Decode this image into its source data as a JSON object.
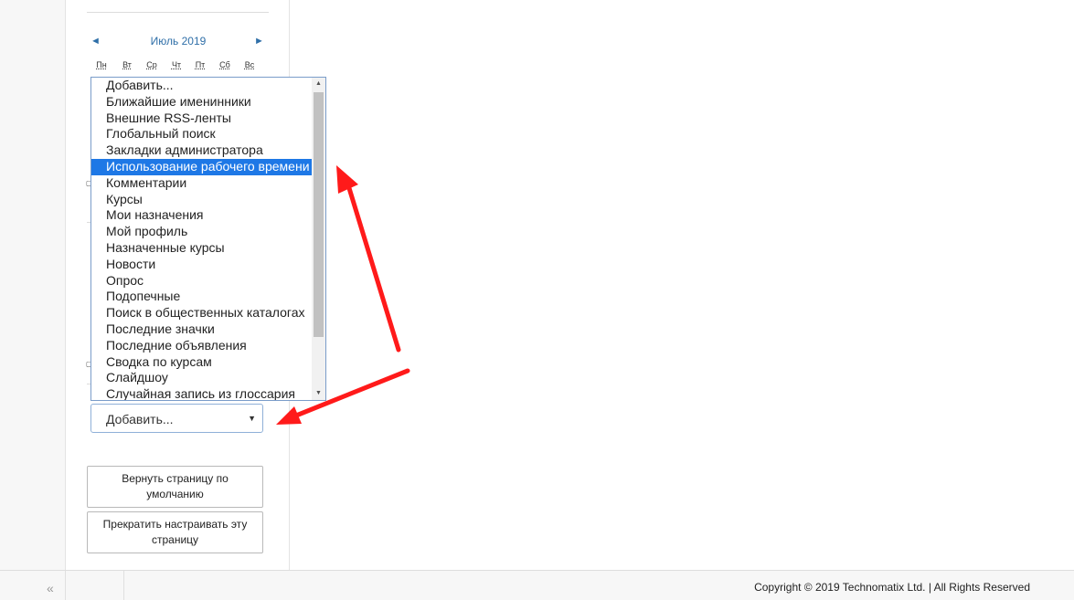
{
  "calendar": {
    "prev_icon": "triangle-left-icon",
    "next_icon": "triangle-right-icon",
    "prev_glyph": "◄",
    "next_glyph": "►",
    "title": "Июль 2019",
    "days": [
      "Пн",
      "Вт",
      "Ср",
      "Чт",
      "Пт",
      "Сб",
      "Вс"
    ]
  },
  "block_list": {
    "items": [
      "Добавить...",
      "Ближайшие именинники",
      "Внешние RSS-ленты",
      "Глобальный поиск",
      "Закладки администратора",
      "Использование рабочего времени",
      "Комментарии",
      "Курсы",
      "Мои назначения",
      "Мой профиль",
      "Назначенные курсы",
      "Новости",
      "Опрос",
      "Подопечные",
      "Поиск в общественных каталогах",
      "Последние значки",
      "Последние объявления",
      "Сводка по курсам",
      "Слайдшоу",
      "Случайная запись из глоссария"
    ],
    "selected_item": "Использование рабочего времени"
  },
  "add_block": {
    "value": "Добавить...",
    "caret": "▼"
  },
  "buttons": {
    "reset": "Вернуть страницу по умолчанию",
    "stop": "Прекратить настраивать эту страницу"
  },
  "footer": {
    "collapse_glyph": "«",
    "copyright": "Copyright © 2019 Technomatix Ltd. | All Rights Reserved"
  },
  "annotation": {
    "arrow_color": "#ff1a1a"
  }
}
